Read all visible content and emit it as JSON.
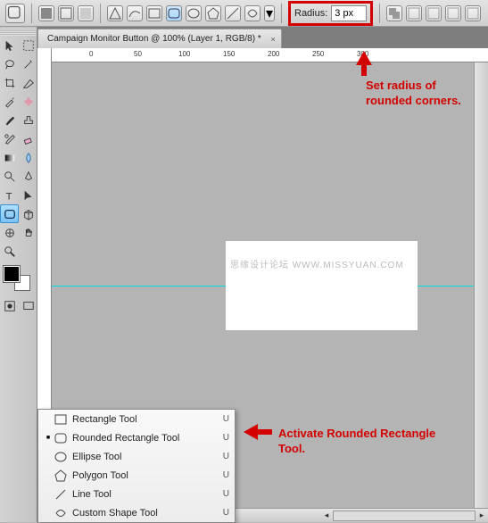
{
  "options": {
    "radius_label": "Radius:",
    "radius_value": "3 px"
  },
  "tab": {
    "title": "Campaign Monitor Button @ 100% (Layer 1, RGB/8) *"
  },
  "ruler": {
    "ticks": [
      "0",
      "50",
      "100",
      "150",
      "200",
      "250",
      "300"
    ]
  },
  "zoom": {
    "value": "100%"
  },
  "watermark": {
    "text": "思缘设计论坛 WWW.MISSYUAN.COM"
  },
  "flyout": {
    "items": [
      {
        "label": "Rectangle Tool",
        "key": "U",
        "selected": false
      },
      {
        "label": "Rounded Rectangle Tool",
        "key": "U",
        "selected": true
      },
      {
        "label": "Ellipse Tool",
        "key": "U",
        "selected": false
      },
      {
        "label": "Polygon Tool",
        "key": "U",
        "selected": false
      },
      {
        "label": "Line Tool",
        "key": "U",
        "selected": false
      },
      {
        "label": "Custom Shape Tool",
        "key": "U",
        "selected": false
      }
    ]
  },
  "annotations": {
    "radius": "Set radius of\nrounded corners.",
    "activate": "Activate Rounded Rectangle\nTool."
  }
}
